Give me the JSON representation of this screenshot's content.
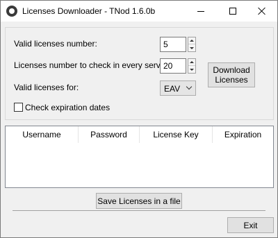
{
  "window": {
    "title": "Licenses Downloader - TNod 1.6.0b",
    "controls": {
      "minimize": "minimize-icon",
      "maximize": "maximize-icon",
      "close": "close-icon"
    }
  },
  "form": {
    "valid_licenses_number": {
      "label": "Valid licenses number:",
      "value": "5"
    },
    "licenses_per_server": {
      "label": "Licenses number to check in every server:",
      "value": "20"
    },
    "valid_for": {
      "label": "Valid licenses for:",
      "selected": "EAV"
    },
    "check_expiration": {
      "label": "Check expiration dates",
      "checked": false
    },
    "download_button": {
      "line1": "Download",
      "line2": "Licenses"
    }
  },
  "table": {
    "columns": [
      "Username",
      "Password",
      "License Key",
      "Expiration"
    ],
    "rows": []
  },
  "footer": {
    "save_label": "Save Licenses in a file",
    "exit_label": "Exit"
  }
}
